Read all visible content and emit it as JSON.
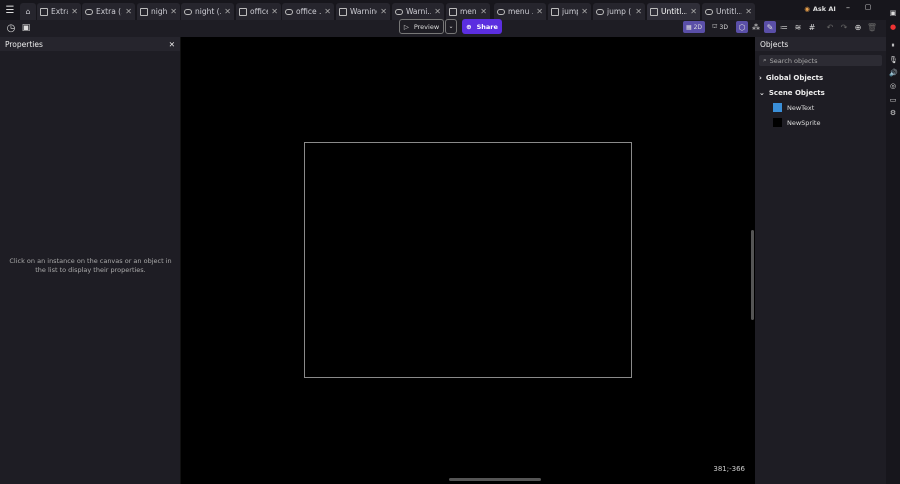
{
  "tabs": [
    {
      "label": "Extra",
      "type": "scene"
    },
    {
      "label": "Extra (...",
      "type": "events"
    },
    {
      "label": "night",
      "type": "scene"
    },
    {
      "label": "night (...",
      "type": "events"
    },
    {
      "label": "office",
      "type": "scene"
    },
    {
      "label": "office ...",
      "type": "events"
    },
    {
      "label": "Warning",
      "type": "scene"
    },
    {
      "label": "Warni...",
      "type": "events"
    },
    {
      "label": "menu",
      "type": "scene"
    },
    {
      "label": "menu ...",
      "type": "events"
    },
    {
      "label": "jump",
      "type": "scene"
    },
    {
      "label": "jump (...",
      "type": "events"
    },
    {
      "label": "Untitl...",
      "type": "scene",
      "active": true
    },
    {
      "label": "Untitl...",
      "type": "events"
    }
  ],
  "header": {
    "ask_ai": "Ask AI",
    "preview": "Preview",
    "share": "Share",
    "mode_2d": "2D",
    "mode_3d": "3D"
  },
  "properties": {
    "title": "Properties",
    "empty_message": "Click on an instance on the canvas or an object in the list to display their properties."
  },
  "canvas": {
    "coords": "381;-366"
  },
  "objects": {
    "title": "Objects",
    "search_placeholder": "Search objects",
    "global": "Global Objects",
    "scene": "Scene Objects",
    "items": [
      {
        "name": "NewText",
        "color": "#3a8fd8"
      },
      {
        "name": "NewSprite",
        "color": "#000000"
      }
    ]
  },
  "colors": {
    "accent": "#5b2ee0"
  }
}
